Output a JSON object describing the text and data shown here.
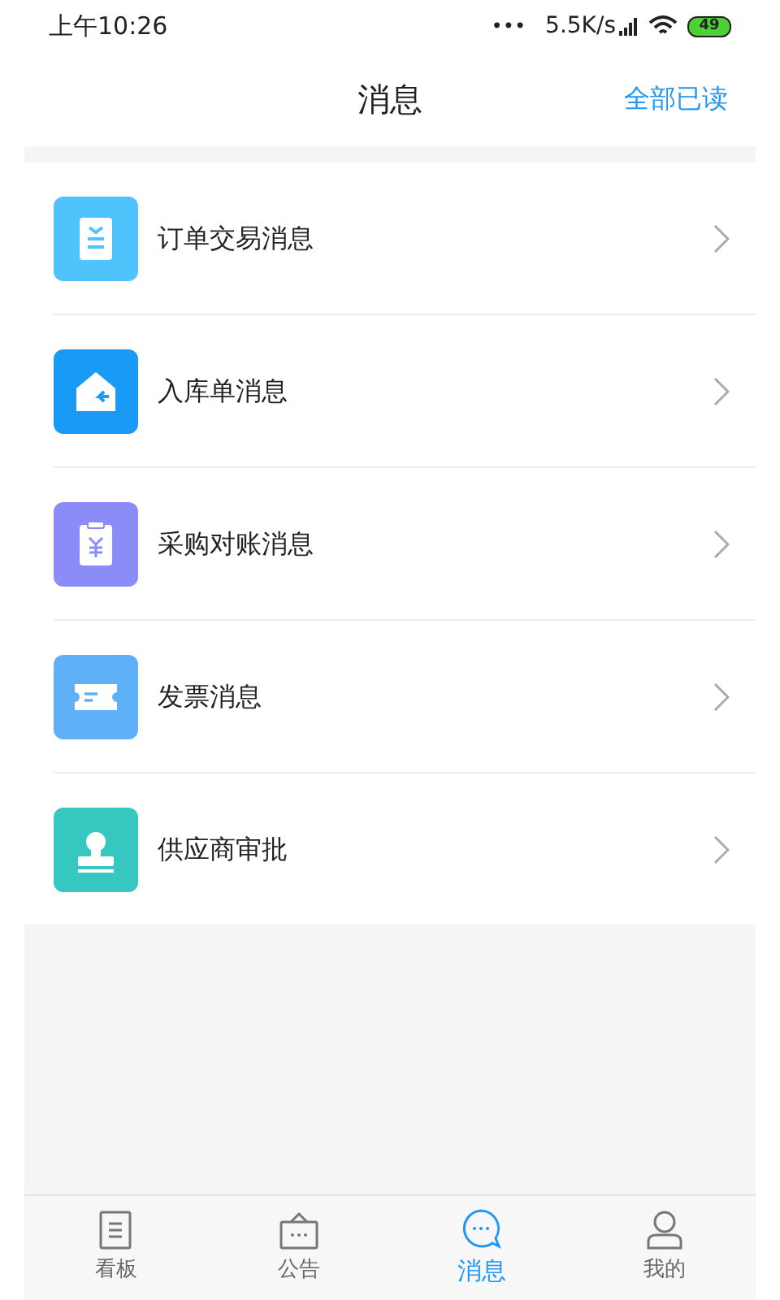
{
  "status_bar": {
    "time": "上午10:26",
    "dots": "•••",
    "speed": "5.5K/s",
    "battery": "49"
  },
  "header": {
    "title": "消息",
    "action": "全部已读"
  },
  "messages": [
    {
      "kind": "order",
      "label": "订单交易消息",
      "color": "#4fc3fc"
    },
    {
      "kind": "warehouse",
      "label": "入库单消息",
      "color": "#1a9af7"
    },
    {
      "kind": "reconcile",
      "label": "采购对账消息",
      "color": "#8b8cf7"
    },
    {
      "kind": "invoice",
      "label": "发票消息",
      "color": "#5eb0f7"
    },
    {
      "kind": "approval",
      "label": "供应商审批",
      "color": "#36c7c0"
    }
  ],
  "tabs": [
    {
      "kind": "board",
      "label": "看板",
      "selected": false
    },
    {
      "kind": "notice",
      "label": "公告",
      "selected": false
    },
    {
      "kind": "message",
      "label": "消息",
      "selected": true
    },
    {
      "kind": "me",
      "label": "我的",
      "selected": false
    }
  ]
}
